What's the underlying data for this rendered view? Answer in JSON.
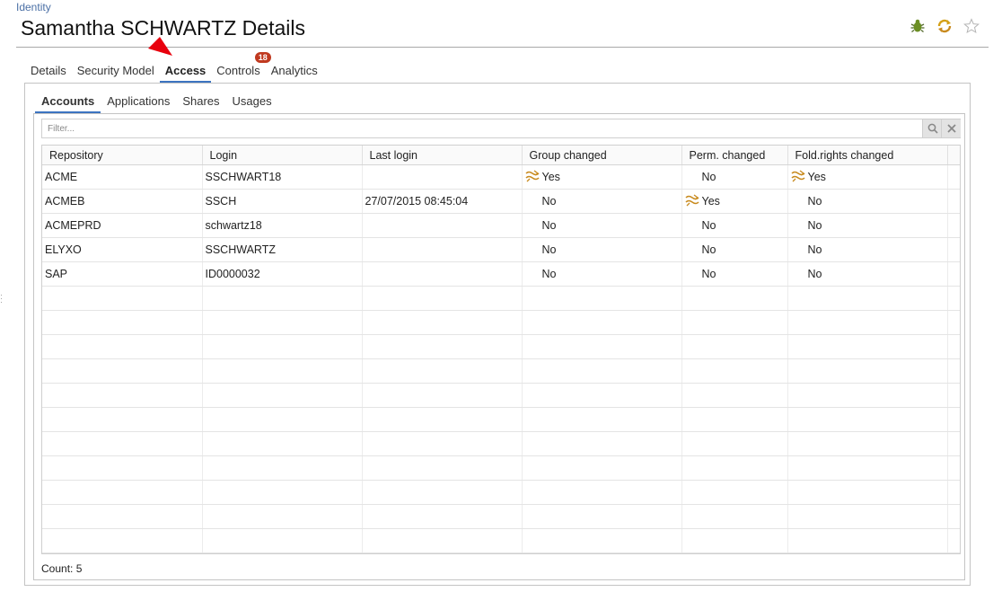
{
  "breadcrumb": "Identity",
  "title": "Samantha SCHWARTZ Details",
  "header_icons": [
    "bug-icon",
    "sync-icon",
    "star-icon"
  ],
  "tabs": [
    {
      "label": "Details"
    },
    {
      "label": "Security Model"
    },
    {
      "label": "Access",
      "active": true
    },
    {
      "label": "Controls",
      "badge": "18"
    },
    {
      "label": "Analytics"
    }
  ],
  "subtabs": [
    {
      "label": "Accounts",
      "active": true
    },
    {
      "label": "Applications"
    },
    {
      "label": "Shares"
    },
    {
      "label": "Usages"
    }
  ],
  "filter": {
    "placeholder": "Filter..."
  },
  "table": {
    "columns": [
      "Repository",
      "Login",
      "Last login",
      "Group changed",
      "Perm. changed",
      "Fold.rights changed"
    ],
    "rows": [
      [
        "ACME",
        "SSCHWART18",
        "",
        "Yes",
        "No",
        "Yes"
      ],
      [
        "ACMEB",
        "SSCH",
        "27/07/2015 08:45:04",
        "No",
        "Yes",
        "No"
      ],
      [
        "ACMEPRD",
        "schwartz18",
        "",
        "No",
        "No",
        "No"
      ],
      [
        "ELYXO",
        "SSCHWARTZ",
        "",
        "No",
        "No",
        "No"
      ],
      [
        "SAP",
        "ID0000032",
        "",
        "No",
        "No",
        "No"
      ]
    ]
  },
  "count_label": "Count: 5",
  "colors": {
    "accent": "#3c74c0",
    "badge": "#c0391f",
    "change_icon": "#c88a1e"
  }
}
